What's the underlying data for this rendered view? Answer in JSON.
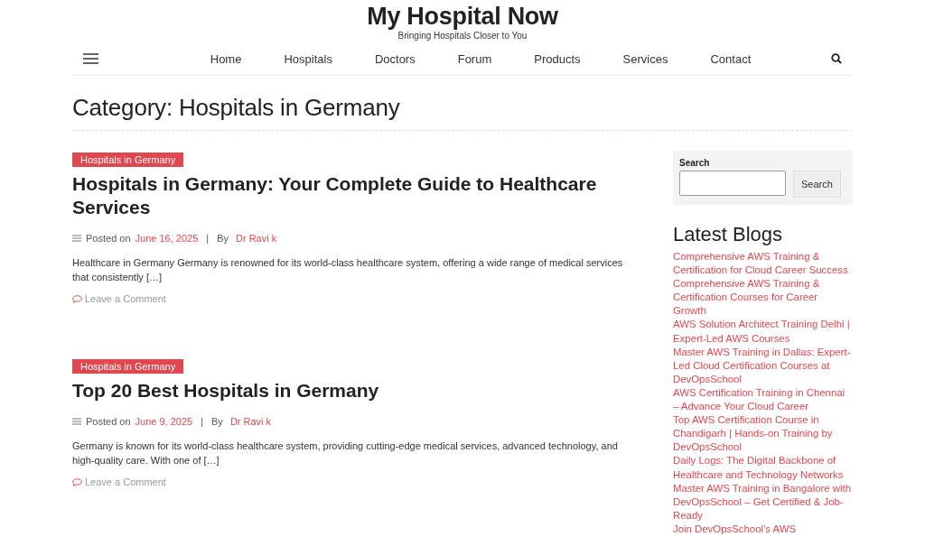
{
  "site": {
    "title": "My Hospital Now",
    "tagline": "Bringing Hospitals Closer to You"
  },
  "nav": {
    "items": [
      "Home",
      "Hospitals",
      "Doctors",
      "Forum",
      "Products",
      "Services",
      "Contact"
    ]
  },
  "page_title": "Category: Hospitals in Germany",
  "posts": [
    {
      "category": "Hospitals in Germany",
      "title": "Hospitals in Germany: Your Complete Guide to Healthcare Services",
      "posted_label": "Posted on",
      "date": "June 16, 2025",
      "separator": "|",
      "by_label": "By",
      "author": "Dr Ravi k",
      "excerpt": "Healthcare in Germany Germany is renowned for its world-class healthcare system, offering a wide range of medical services that consistently […]",
      "comment_link": "Leave a Comment"
    },
    {
      "category": "Hospitals in Germany",
      "title": "Top 20 Best Hospitals in Germany",
      "posted_label": "Posted on",
      "date": "June 9, 2025",
      "separator": "|",
      "by_label": "By",
      "author": "Dr Ravi k",
      "excerpt": "Germany is known for its world-class healthcare system, providing cutting-edge medical services, advanced technology, and high-quality care. With one of […]",
      "comment_link": "Leave a Comment"
    }
  ],
  "sidebar": {
    "search": {
      "label": "Search",
      "button": "Search"
    },
    "latest_title": "Latest Blogs",
    "latest": [
      "Comprehensive AWS Training & Certification for Cloud Career Success",
      "Comprehensive AWS Training & Certification Courses for Career Growth",
      "AWS Solution Architect Training Delhi | Expert-Led AWS Courses",
      "Master AWS Training in Dallas: Expert-Led Cloud Certification Courses at DevOpsSchool",
      "AWS Certification Training in Chennai – Advance Your Cloud Career",
      "Top AWS Certification Course in Chandigarh | Hands-on Training by DevOpsSchool",
      "Daily Logs: The Digital Backbone of Healthcare and Technology Networks",
      "Master AWS Training in Bangalore with DevOpsSchool – Get Certified & Job-Ready",
      "Join DevOpsSchool’s AWS"
    ]
  }
}
